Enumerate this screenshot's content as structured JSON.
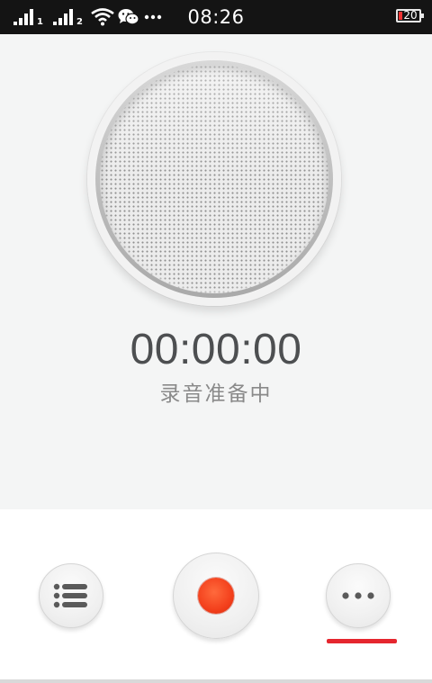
{
  "status_bar": {
    "sim1": "1",
    "sim2": "2",
    "time": "08:26",
    "battery_level": "20",
    "overflow_icon": "more-dots-icon",
    "wifi_icon": "wifi-icon",
    "wechat_icon": "wechat-icon"
  },
  "recorder": {
    "timer": "00:00:00",
    "status": "录音准备中"
  },
  "controls": {
    "list_icon": "list-icon",
    "record_icon": "record-icon",
    "more_icon": "more-icon",
    "selected_indicator_color": "#e5262e"
  }
}
